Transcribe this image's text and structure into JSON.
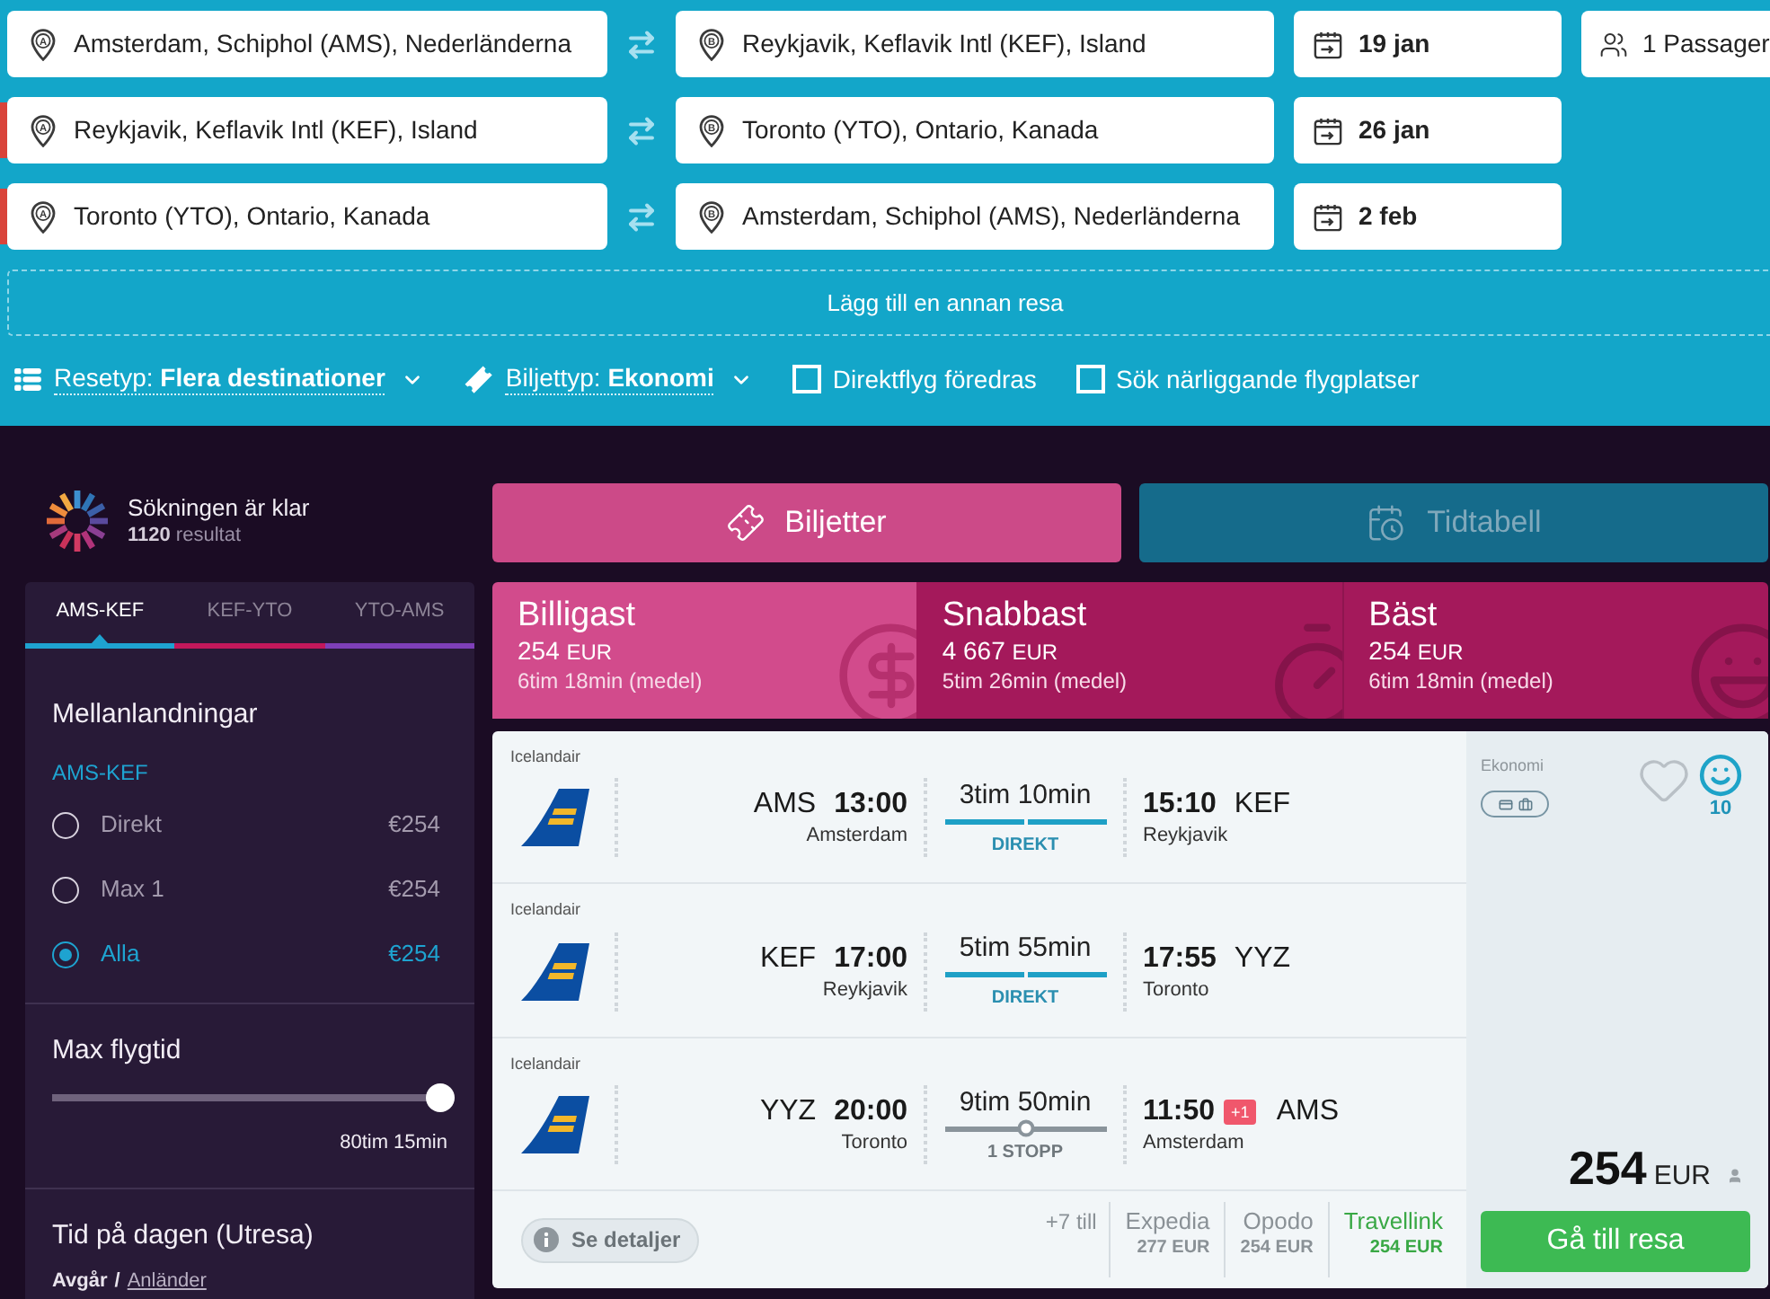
{
  "search": {
    "legs": [
      {
        "origin_marker": "A",
        "origin": "Amsterdam, Schiphol (AMS), Nederländerna",
        "destination_marker": "B",
        "destination": "Reykjavik, Keflavik Intl (KEF), Island",
        "date": "19 jan",
        "marked": false
      },
      {
        "origin_marker": "A",
        "origin": "Reykjavik, Keflavik Intl (KEF), Island",
        "destination_marker": "B",
        "destination": "Toronto (YTO), Ontario, Kanada",
        "date": "26 jan",
        "marked": true
      },
      {
        "origin_marker": "A",
        "origin": "Toronto (YTO), Ontario, Kanada",
        "destination_marker": "B",
        "destination": "Amsterdam, Schiphol (AMS), Nederländerna",
        "date": "2 feb",
        "marked": true
      }
    ],
    "passengers": "1 Passager",
    "add_trip": "Lägg till en annan resa",
    "options": [
      {
        "kind": "dropdown",
        "text": "Resetyp: **Flera destinationer**"
      },
      {
        "kind": "dropdown",
        "text": "Biljettyp: **Ekonomi**"
      },
      {
        "kind": "checkbox",
        "text": "Direktflyg föredras",
        "checked": false
      },
      {
        "kind": "checkbox",
        "text": "Sök närliggande flygplatser",
        "checked": false
      }
    ]
  },
  "status": {
    "title": "Sökningen är klar",
    "results": "**1120** resultat"
  },
  "filters": {
    "tabs": [
      {
        "label": "AMS-KEF",
        "selected": true,
        "color": "#1ea3d0"
      },
      {
        "label": "KEF-YTO",
        "selected": false,
        "color": "#c2185b"
      },
      {
        "label": "YTO-AMS",
        "selected": false,
        "color": "#7e3fb8"
      }
    ],
    "stops": {
      "title": "Mellanlandningar",
      "leg": "AMS-KEF",
      "options": [
        {
          "label": "Direkt",
          "price": "€254",
          "selected": false
        },
        {
          "label": "Max 1",
          "price": "€254",
          "selected": false
        },
        {
          "label": "Alla",
          "price": "€254",
          "selected": true
        }
      ]
    },
    "max_duration": {
      "title": "Max flygtid",
      "level": 1,
      "reading": "80tim 15min"
    },
    "time_of_day": {
      "title": "Tid på dagen (Utresa)",
      "modes": [
        {
          "label": "Avgår",
          "selected": true
        },
        {
          "label": "Anländer",
          "selected": false
        }
      ],
      "separator": "/"
    }
  },
  "view_tabs": [
    {
      "label": "Biljetter",
      "selected": true
    },
    {
      "label": "Tidtabell",
      "selected": false
    }
  ],
  "sort_tabs": [
    {
      "kind": "cheapest",
      "title": "Billigast",
      "price": "254",
      "currency": "EUR",
      "duration": "6tim 18min (medel)",
      "selected": true
    },
    {
      "kind": "fastest",
      "title": "Snabbast",
      "price": "4 667",
      "currency": "EUR",
      "duration": "5tim 26min (medel)",
      "selected": false
    },
    {
      "kind": "best",
      "title": "Bäst",
      "price": "254",
      "currency": "EUR",
      "duration": "6tim 18min (medel)",
      "selected": false
    }
  ],
  "result": {
    "legs": [
      {
        "airline": "Icelandair",
        "from_code": "AMS",
        "from_time": "13:00",
        "from_city": "Amsterdam",
        "duration": "3tim 10min",
        "direct": true,
        "stops": "DIREKT",
        "to_time": "15:10",
        "to_code": "KEF",
        "to_city": "Reykjavik"
      },
      {
        "airline": "Icelandair",
        "from_code": "KEF",
        "from_time": "17:00",
        "from_city": "Reykjavik",
        "duration": "5tim 55min",
        "direct": true,
        "stops": "DIREKT",
        "to_time": "17:55",
        "to_code": "YYZ",
        "to_city": "Toronto"
      },
      {
        "airline": "Icelandair",
        "from_code": "YYZ",
        "from_time": "20:00",
        "from_city": "Toronto",
        "duration": "9tim 50min",
        "direct": false,
        "stops": "1 STOPP",
        "to_time": "11:50",
        "day_offset": "+1",
        "to_code": "AMS",
        "to_city": "Amsterdam"
      }
    ],
    "details": "Se detaljer",
    "more_providers": "+7 till",
    "providers": [
      {
        "name": "Expedia",
        "price": "277 EUR",
        "selected": false
      },
      {
        "name": "Opodo",
        "price": "254 EUR",
        "selected": false
      },
      {
        "name": "Travellink",
        "price": "254 EUR",
        "selected": true
      }
    ],
    "cabin": "Ekonomi",
    "favorite": false,
    "score": "10",
    "price": "254",
    "currency": "EUR",
    "book": "Gå till resa"
  }
}
